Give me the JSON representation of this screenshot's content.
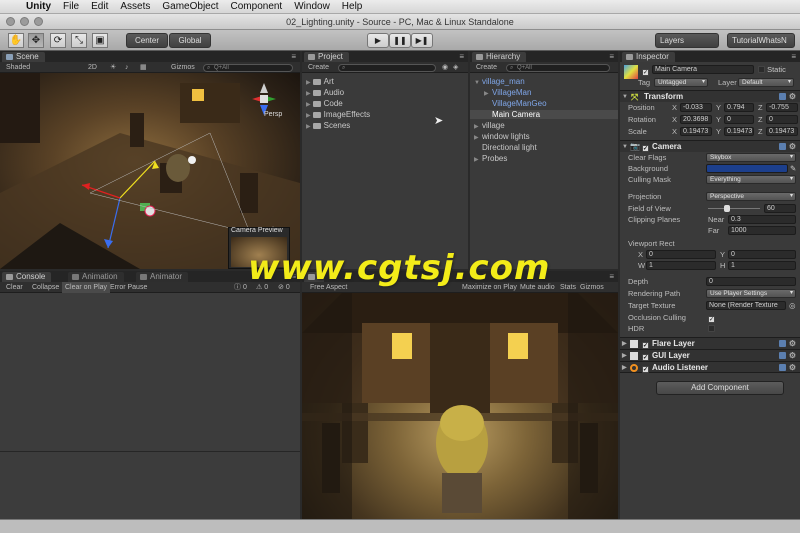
{
  "menubar": {
    "app": "Unity",
    "items": [
      "File",
      "Edit",
      "Assets",
      "GameObject",
      "Component",
      "Window",
      "Help"
    ]
  },
  "window": {
    "title": "02_Lighting.unity - Source - PC, Mac & Linux Standalone"
  },
  "toolbar": {
    "pivot_label": "Center",
    "space_label": "Global",
    "layers_label": "Layers",
    "layout_label": "TutorialWhatsN"
  },
  "scene": {
    "tab": "Scene",
    "shading": "Shaded",
    "mode2d": "2D",
    "gizmos": "Gizmos",
    "search_placeholder": "Q+All",
    "persp_label": "Persp",
    "camera_preview_label": "Camera Preview"
  },
  "project": {
    "tab": "Project",
    "create_label": "Create",
    "folders": [
      "Art",
      "Audio",
      "Code",
      "ImageEffects",
      "Scenes"
    ]
  },
  "hierarchy": {
    "tab": "Hierarchy",
    "create_label": "Create",
    "search_placeholder": "Q+All",
    "items": [
      {
        "label": "village_man",
        "style": "blue",
        "indent": 0,
        "arrow": "▼"
      },
      {
        "label": "VillageMan",
        "style": "blue",
        "indent": 1,
        "arrow": "▶"
      },
      {
        "label": "VillageManGeo",
        "style": "blue",
        "indent": 1,
        "arrow": ""
      },
      {
        "label": "Main Camera",
        "style": "selected",
        "indent": 1,
        "arrow": ""
      },
      {
        "label": "village",
        "style": "normal",
        "indent": 0,
        "arrow": "▶"
      },
      {
        "label": "window lights",
        "style": "normal",
        "indent": 0,
        "arrow": "▶"
      },
      {
        "label": "Directional light",
        "style": "normal",
        "indent": 0,
        "arrow": ""
      },
      {
        "label": "Probes",
        "style": "normal",
        "indent": 0,
        "arrow": "▶"
      }
    ]
  },
  "inspector": {
    "tab": "Inspector",
    "object_name": "Main Camera",
    "static_label": "Static",
    "tag_label": "Tag",
    "tag_value": "Untagged",
    "layer_label": "Layer",
    "layer_value": "Default",
    "transform": {
      "header": "Transform",
      "position_label": "Position",
      "position": [
        "-0.033",
        "0.794",
        "-0.755"
      ],
      "rotation_label": "Rotation",
      "rotation": [
        "20.3698",
        "0",
        "0"
      ],
      "scale_label": "Scale",
      "scale": [
        "0.19473",
        "0.19473",
        "0.19473"
      ]
    },
    "camera": {
      "header": "Camera",
      "clear_flags_label": "Clear Flags",
      "clear_flags": "Skybox",
      "background_label": "Background",
      "background_color": "#1c3f8c",
      "culling_mask_label": "Culling Mask",
      "culling_mask": "Everything",
      "projection_label": "Projection",
      "projection": "Perspective",
      "fov_label": "Field of View",
      "fov": "60",
      "clipping_label": "Clipping Planes",
      "near_label": "Near",
      "near": "0.3",
      "far_label": "Far",
      "far": "1000",
      "viewport_label": "Viewport Rect",
      "vx": "0",
      "vy": "0",
      "vw": "1",
      "vh": "1",
      "depth_label": "Depth",
      "depth": "0",
      "rendering_path_label": "Rendering Path",
      "rendering_path": "Use Player Settings",
      "target_texture_label": "Target Texture",
      "target_texture": "None (Render Texture",
      "occlusion_label": "Occlusion Culling",
      "hdr_label": "HDR"
    },
    "flare_layer": "Flare Layer",
    "gui_layer": "GUI Layer",
    "audio_listener": "Audio Listener",
    "add_component": "Add Component"
  },
  "console": {
    "tab": "Console",
    "buttons": [
      "Clear",
      "Collapse",
      "Clear on Play",
      "Error Pause"
    ],
    "counts": [
      "0",
      "0",
      "0"
    ]
  },
  "animation_tab": "Animation",
  "animator_tab": "Animator",
  "game": {
    "aspect": "Free Aspect",
    "buttons": [
      "Maximize on Play",
      "Mute audio",
      "Stats",
      "Gizmos"
    ]
  },
  "watermark": "www.cgtsj.com"
}
